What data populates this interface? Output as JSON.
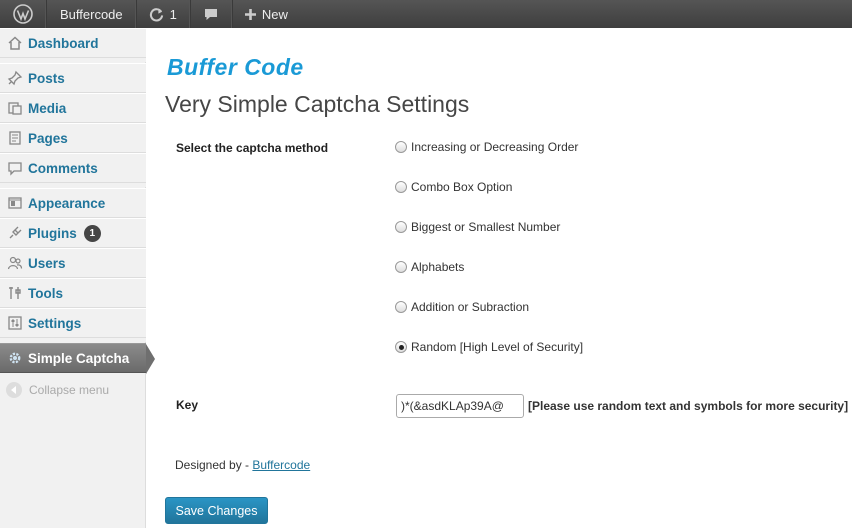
{
  "adminbar": {
    "site_name": "Buffercode",
    "updates_count": "1",
    "new_label": "New"
  },
  "sidebar": {
    "items": [
      {
        "label": "Dashboard"
      },
      {
        "label": "Posts"
      },
      {
        "label": "Media"
      },
      {
        "label": "Pages"
      },
      {
        "label": "Comments"
      },
      {
        "label": "Appearance"
      },
      {
        "label": "Plugins",
        "badge": "1"
      },
      {
        "label": "Users"
      },
      {
        "label": "Tools"
      },
      {
        "label": "Settings"
      },
      {
        "label": "Simple Captcha"
      }
    ],
    "collapse_label": "Collapse menu"
  },
  "brand": {
    "logo_text": "Buffer Code",
    "logo_color": "#1a9ad6"
  },
  "page": {
    "title": "Very Simple Captcha Settings",
    "method_label": "Select the captcha method",
    "methods": [
      {
        "label": "Increasing or Decreasing Order",
        "checked": false
      },
      {
        "label": "Combo Box Option",
        "checked": false
      },
      {
        "label": "Biggest or Smallest Number",
        "checked": false
      },
      {
        "label": "Alphabets",
        "checked": false
      },
      {
        "label": "Addition or Subraction",
        "checked": false
      },
      {
        "label": "Random [High Level of Security]",
        "checked": true
      }
    ],
    "key_label": "Key",
    "key_value": ")*(&asdKLAp39A@",
    "key_hint": "[Please use random text and symbols for more security]",
    "designed_by": "Designed by - ",
    "designed_link": "Buffercode",
    "save_label": "Save Changes"
  },
  "colors": {
    "link": "#21759b",
    "button": "#21759b",
    "adminbar": "#464646"
  }
}
